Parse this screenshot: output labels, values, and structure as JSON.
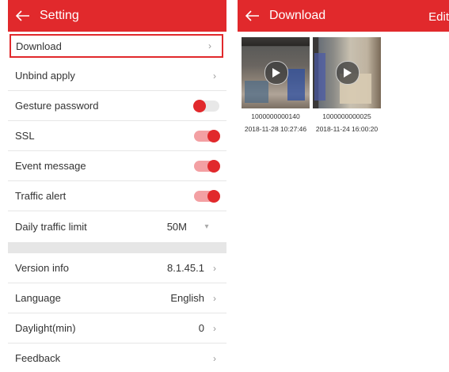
{
  "left_panel": {
    "header": {
      "title": "Setting",
      "back_icon": "arrow-left-icon"
    },
    "rows": [
      {
        "label": "Download",
        "kind": "link"
      },
      {
        "label": "Unbind apply",
        "kind": "link"
      },
      {
        "label": "Gesture password",
        "kind": "toggle",
        "on": false
      },
      {
        "label": "SSL",
        "kind": "toggle",
        "on": true
      },
      {
        "label": "Event message",
        "kind": "toggle",
        "on": true
      },
      {
        "label": "Traffic alert",
        "kind": "toggle",
        "on": true
      },
      {
        "label": "Daily traffic limit",
        "kind": "select",
        "value": "50M"
      },
      {
        "label": "Version info",
        "kind": "link",
        "value": "8.1.45.1"
      },
      {
        "label": "Language",
        "kind": "link",
        "value": "English"
      },
      {
        "label": "Daylight(min)",
        "kind": "link",
        "value": "0"
      },
      {
        "label": "Feedback",
        "kind": "link"
      }
    ]
  },
  "right_panel": {
    "header": {
      "title": "Download",
      "edit_label": "Edit",
      "back_icon": "arrow-left-icon"
    },
    "videos": [
      {
        "id": "1000000000140",
        "timestamp": "2018-11-28 10:27:46"
      },
      {
        "id": "1000000000025",
        "timestamp": "2018-11-24 16:00:20"
      }
    ]
  },
  "colors": {
    "accent": "#e1292c",
    "toggle_track_on": "#f3a0a3",
    "toggle_track_off": "#e8e8e8",
    "divider": "#e6e6e6"
  }
}
